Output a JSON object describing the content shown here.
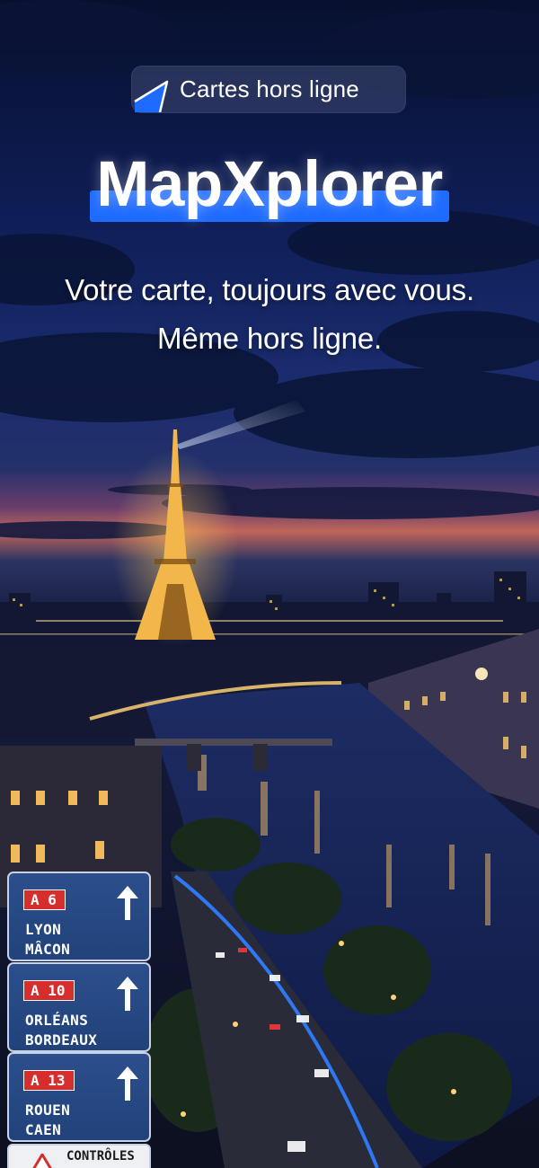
{
  "badge": {
    "label": "Cartes hors ligne",
    "icon": "navigation-arrow-icon",
    "accent_color": "#1e6bff"
  },
  "app": {
    "title": "MapXplorer",
    "underline_color": "#1e6bff"
  },
  "tagline": {
    "line1": "Votre carte, toujours avec vous.",
    "line2": "Même hors ligne."
  },
  "road_signs": [
    {
      "route": "A 6",
      "cities": [
        "LYON",
        "MÂCON"
      ]
    },
    {
      "route": "A 10",
      "cities": [
        "ORLÉANS",
        "BORDEAUX"
      ]
    },
    {
      "route": "A 13",
      "cities": [
        "ROUEN",
        "CAEN"
      ]
    }
  ],
  "controls_sign": {
    "label": "CONTRÔLES"
  }
}
